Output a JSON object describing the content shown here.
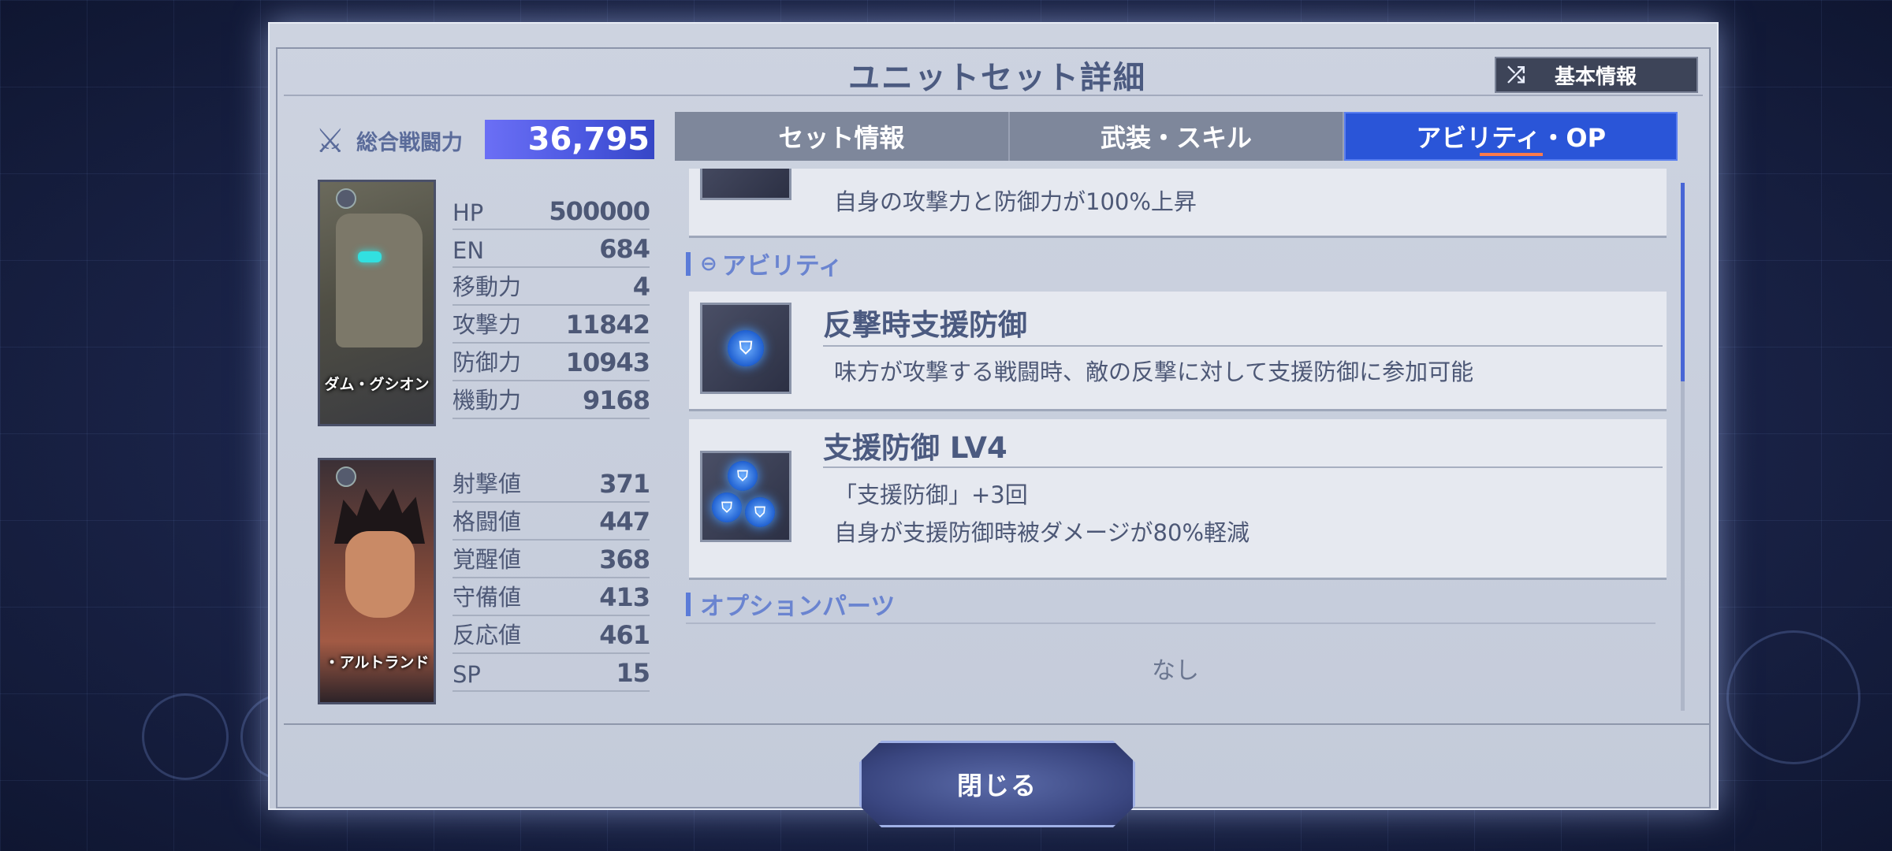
{
  "title": "ユニットセット詳細",
  "basic_info_button": "基本情報",
  "total_power": {
    "label": "総合戦闘力",
    "value": "36,795"
  },
  "unit": {
    "name": "ダム・グシオン",
    "stats": [
      {
        "label": "HP",
        "value": "500000"
      },
      {
        "label": "EN",
        "value": "684"
      },
      {
        "label": "移動力",
        "value": "4"
      },
      {
        "label": "攻撃力",
        "value": "11842"
      },
      {
        "label": "防御力",
        "value": "10943"
      },
      {
        "label": "機動力",
        "value": "9168"
      }
    ]
  },
  "pilot": {
    "name": "・アルトランド",
    "stats": [
      {
        "label": "射撃値",
        "value": "371"
      },
      {
        "label": "格闘値",
        "value": "447"
      },
      {
        "label": "覚醒値",
        "value": "368"
      },
      {
        "label": "守備値",
        "value": "413"
      },
      {
        "label": "反応値",
        "value": "461"
      },
      {
        "label": "SP",
        "value": "15"
      }
    ]
  },
  "tabs": [
    {
      "label": "セット情報",
      "active": false
    },
    {
      "label": "武装・スキル",
      "active": false
    },
    {
      "label": "アビリティ・OP",
      "active": true
    }
  ],
  "content": {
    "partial_card_desc": "自身の攻撃力と防御力が100%上昇",
    "ability_section": "アビリティ",
    "abilities": [
      {
        "title": "反撃時支援防御",
        "desc": "味方が攻撃する戦闘時、敵の反撃に対して支援防御に参加可能"
      },
      {
        "title": "支援防御 LV4",
        "desc1": "「支援防御」+3回",
        "desc2": "自身が支援防御時被ダメージが80%軽減"
      }
    ],
    "option_section": "オプションパーツ",
    "option_none": "なし"
  },
  "close_button": "閉じる",
  "colors": {
    "active_tab": "#2a55d8",
    "power_bar": "#4a57e0",
    "accent_text": "#6a84d0"
  }
}
